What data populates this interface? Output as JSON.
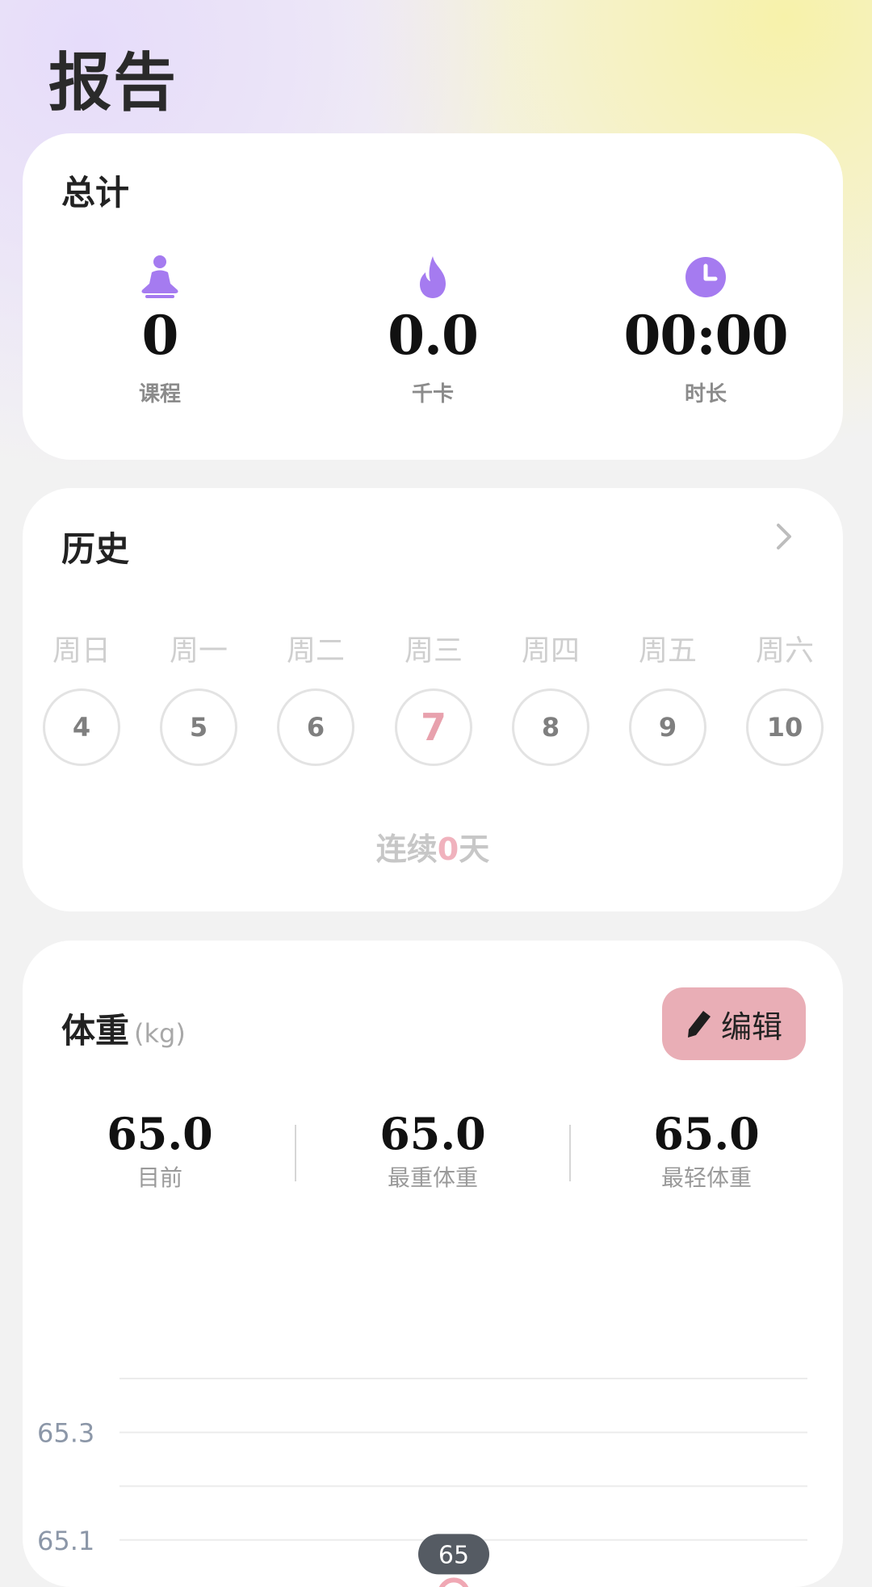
{
  "page_title": "报告",
  "totals": {
    "title": "总计",
    "items": [
      {
        "icon": "meditation-icon",
        "value": "0",
        "label": "课程"
      },
      {
        "icon": "flame-icon",
        "value": "0.0",
        "label": "千卡"
      },
      {
        "icon": "clock-icon",
        "value": "00:00",
        "label": "时长"
      }
    ]
  },
  "history": {
    "title": "历史",
    "weekdays": [
      "周日",
      "周一",
      "周二",
      "周三",
      "周四",
      "周五",
      "周六"
    ],
    "days": [
      "4",
      "5",
      "6",
      "7",
      "8",
      "9",
      "10"
    ],
    "today_index": 3,
    "streak_prefix": "连续",
    "streak_count": "0",
    "streak_suffix": "天"
  },
  "weight": {
    "title": "体重",
    "unit": "(kg)",
    "edit_label": "编辑",
    "stats": [
      {
        "value": "65.0",
        "label": "目前"
      },
      {
        "value": "65.0",
        "label": "最重体重"
      },
      {
        "value": "65.0",
        "label": "最轻体重"
      }
    ]
  },
  "chart_data": {
    "type": "line",
    "y_tick_labels": [
      "65.3",
      "65.1"
    ],
    "gridlines": [
      65.4,
      65.3,
      65.2,
      65.1
    ],
    "points": [
      {
        "x_index": 3,
        "y": 65
      }
    ],
    "point_label": "65",
    "series_color": "#6b52d9",
    "point_color": "#f0a8b4",
    "grid": true
  },
  "colors": {
    "accent_purple": "#a57bf0",
    "pink": "#e9aeb6"
  }
}
